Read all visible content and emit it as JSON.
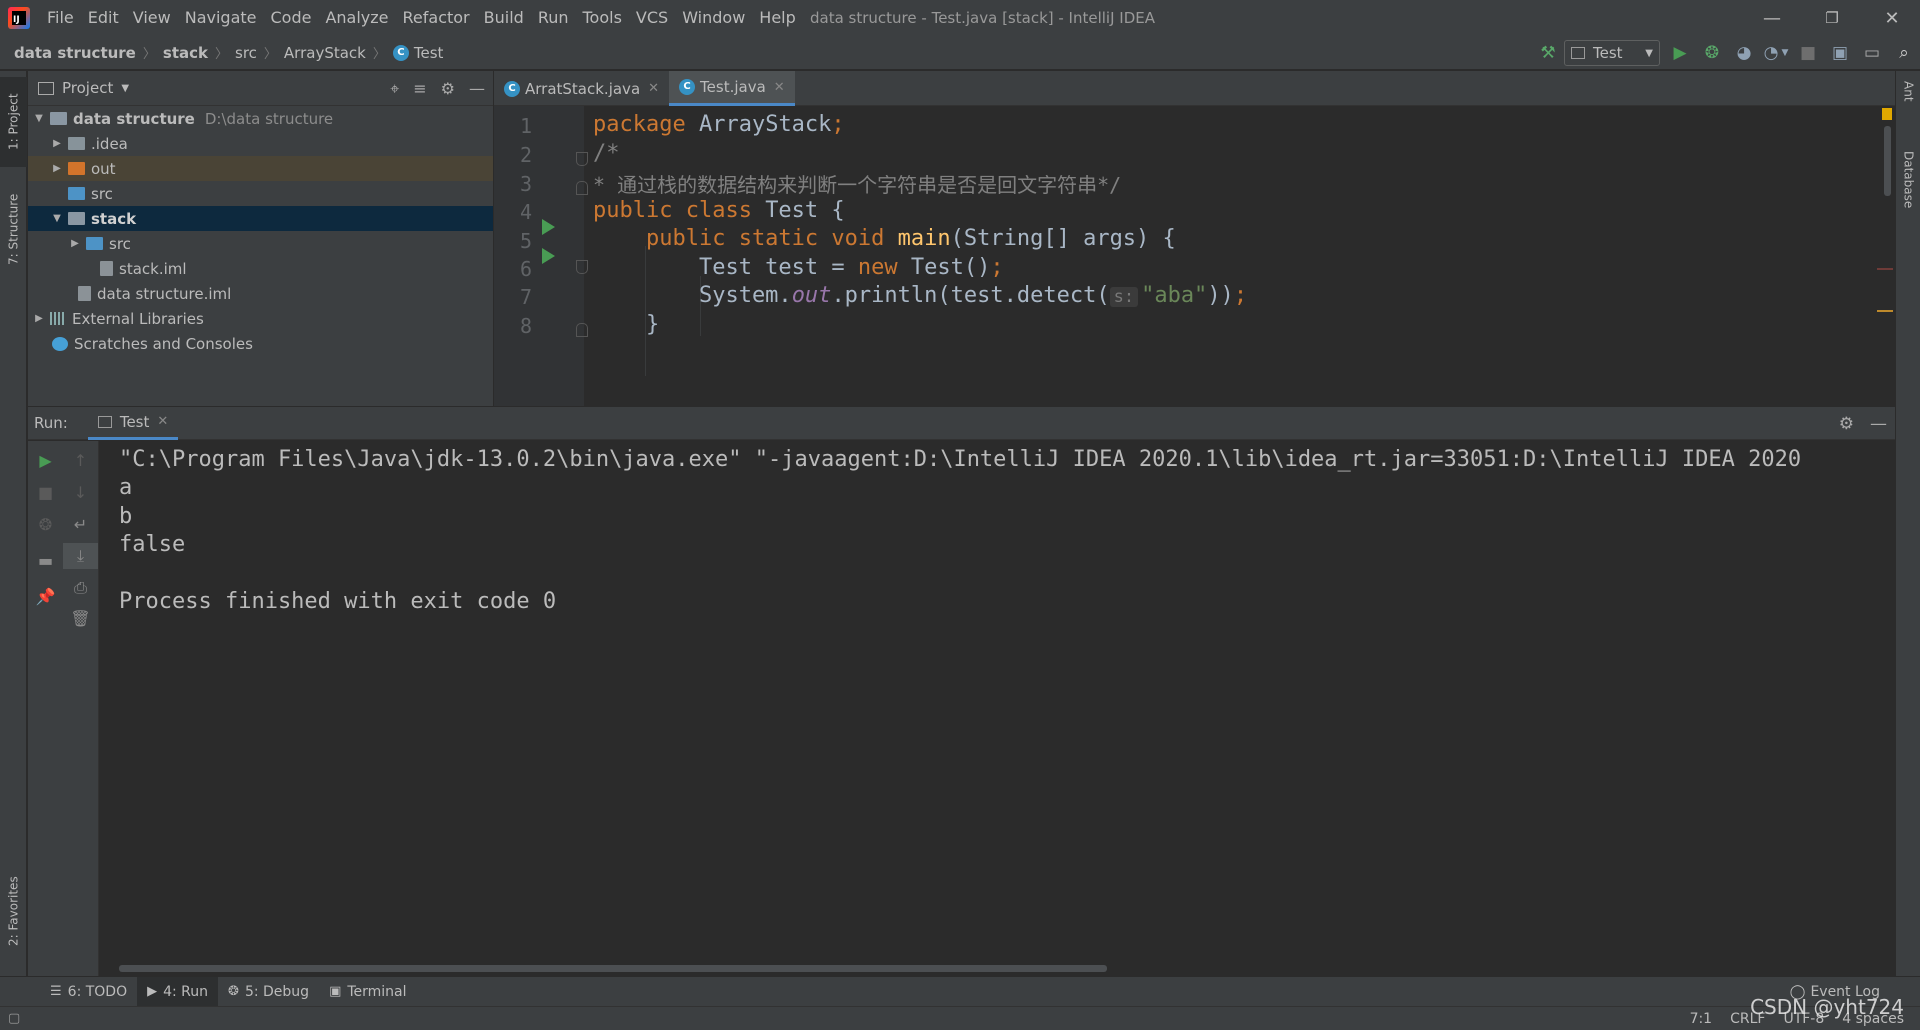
{
  "menu": [
    "File",
    "Edit",
    "View",
    "Navigate",
    "Code",
    "Analyze",
    "Refactor",
    "Build",
    "Run",
    "Tools",
    "VCS",
    "Window",
    "Help"
  ],
  "window_title": "data structure - Test.java [stack] - IntelliJ IDEA",
  "breadcrumbs": [
    "data structure",
    "stack",
    "src",
    "ArrayStack",
    "Test"
  ],
  "run_config": "Test",
  "left_strip": {
    "project": "1: Project",
    "structure": "7: Structure",
    "favorites": "2: Favorites"
  },
  "right_strip": {
    "ant": "Ant",
    "database": "Database"
  },
  "project_panel": {
    "title": "Project",
    "tree": [
      {
        "label": "data structure",
        "hint": "D:\\data structure",
        "depth": 0,
        "expanded": true,
        "icon": "module-folder",
        "bold": true
      },
      {
        "label": ".idea",
        "depth": 1,
        "expanded": false,
        "icon": "folder"
      },
      {
        "label": "out",
        "depth": 1,
        "expanded": false,
        "icon": "excluded-folder"
      },
      {
        "label": "src",
        "depth": 1,
        "icon": "source-folder"
      },
      {
        "label": "stack",
        "depth": 1,
        "expanded": true,
        "icon": "module-folder",
        "bold": true,
        "selected": true
      },
      {
        "label": "src",
        "depth": 2,
        "expanded": false,
        "icon": "source-folder"
      },
      {
        "label": "stack.iml",
        "depth": 2,
        "icon": "iml-file"
      },
      {
        "label": "data structure.iml",
        "depth": 1,
        "icon": "iml-file"
      },
      {
        "label": "External Libraries",
        "depth": 0,
        "expanded": false,
        "icon": "library"
      },
      {
        "label": "Scratches and Consoles",
        "depth": 0,
        "icon": "scratch"
      }
    ]
  },
  "editor": {
    "tabs": [
      {
        "label": "ArratStack.java",
        "active": false
      },
      {
        "label": "Test.java",
        "active": true
      }
    ],
    "line_numbers": [
      "1",
      "2",
      "3",
      "4",
      "5",
      "6",
      "7",
      "8"
    ],
    "code": {
      "l1_kw": "package ",
      "l1_rest": "ArrayStack",
      "l1_semi": ";",
      "l2": "/*",
      "l3": "* 通过栈的数据结构来判断一个字符串是否是回文字符串*/",
      "l4_kw": "public class ",
      "l4_rest": "Test {",
      "l5_kw": "    public static void ",
      "l5_fn": "main",
      "l5_rest": "(String[] args) {",
      "l6_a": "        Test test = ",
      "l6_kw": "new ",
      "l6_b": "Test()",
      "l6_semi": ";",
      "l7_a": "        System.",
      "l7_field": "out",
      "l7_b": ".println(test.detect(",
      "l7_hint": "s:",
      "l7_str": "\"aba\"",
      "l7_c": "))",
      "l7_semi": ";",
      "l8": "    }"
    }
  },
  "run_panel": {
    "label": "Run:",
    "tab": "Test",
    "console": [
      "\"C:\\Program Files\\Java\\jdk-13.0.2\\bin\\java.exe\" \"-javaagent:D:\\IntelliJ IDEA 2020.1\\lib\\idea_rt.jar=33051:D:\\IntelliJ IDEA 2020",
      "a",
      "b",
      "false",
      "",
      "Process finished with exit code 0"
    ]
  },
  "bottom_tabs": [
    {
      "label": "6: TODO",
      "icon": "todo-icon",
      "active": false
    },
    {
      "label": "4: Run",
      "icon": "run-icon",
      "active": true
    },
    {
      "label": "5: Debug",
      "icon": "debug-icon",
      "active": false
    },
    {
      "label": "Terminal",
      "icon": "terminal-icon",
      "active": false
    }
  ],
  "event_log": "Event Log",
  "status": {
    "position": "7:1",
    "line_sep": "CRLF",
    "encoding": "UTF-8",
    "indent": "4 spaces"
  },
  "watermark": "CSDN @yht724",
  "colors": {
    "keyword": "#cc7832",
    "string": "#6a8759",
    "function": "#ffc66d",
    "comment": "#808080",
    "field": "#9876aa",
    "selection": "#0d293e",
    "accent": "#4a88c7"
  }
}
